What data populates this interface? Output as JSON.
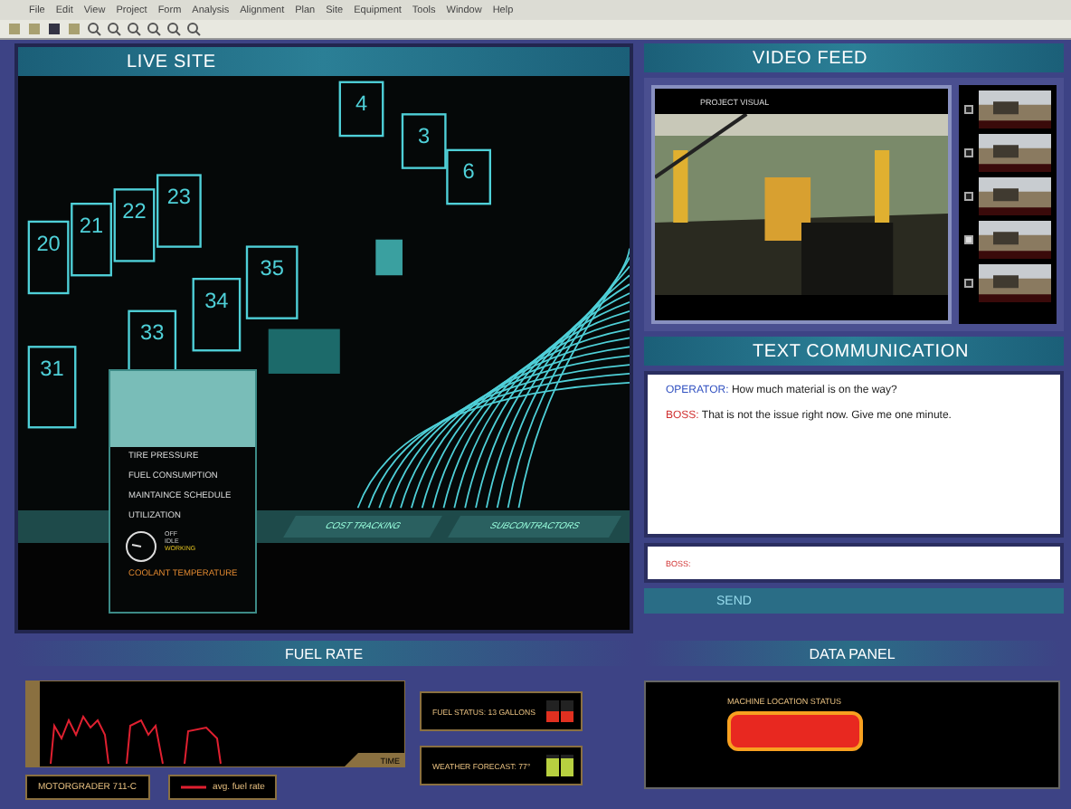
{
  "menu": [
    "File",
    "Edit",
    "View",
    "Project",
    "Form",
    "Analysis",
    "Alignment",
    "Plan",
    "Site",
    "Equipment",
    "Tools",
    "Window",
    "Help"
  ],
  "live_site": {
    "title": "LIVE SITE",
    "lots": [
      "20",
      "21",
      "22",
      "23",
      "31",
      "33",
      "34",
      "35",
      "3",
      "4",
      "6"
    ],
    "tabs": [
      {
        "label": "COST TRACKING",
        "selected": false
      },
      {
        "label": "SUBCONTRACTORS",
        "selected": false
      }
    ],
    "popup": {
      "items": [
        "TIRE PRESSURE",
        "FUEL CONSUMPTION",
        "MAINTAINCE SCHEDULE",
        "UTILIZATION"
      ],
      "legend": [
        {
          "label": "OFF",
          "selected": false
        },
        {
          "label": "IDLE",
          "selected": false
        },
        {
          "label": "WORKING",
          "selected": true
        }
      ],
      "footer": "COOLANT TEMPERATURE"
    }
  },
  "video_feed": {
    "title": "VIDEO FEED",
    "caption": "PROJECT VISUAL",
    "thumbnails": [
      {
        "checked": false
      },
      {
        "checked": false
      },
      {
        "checked": false
      },
      {
        "checked": true
      },
      {
        "checked": false
      }
    ]
  },
  "text_communication": {
    "title": "TEXT COMMUNICATION",
    "messages": [
      {
        "sender": "OPERATOR:",
        "text": "How much material is on the way?",
        "color": "#3050c0"
      },
      {
        "sender": "BOSS:",
        "text": "That is not the issue right now. Give me one minute.",
        "color": "#d03030"
      }
    ],
    "input_value": "BOSS:",
    "send": "SEND"
  },
  "fuel_rate": {
    "title": "FUEL RATE",
    "axis_label": "TIME",
    "machine": "MOTORGRADER 711-C",
    "legend": "avg. fuel rate"
  },
  "status_boxes": [
    {
      "label": "FUEL STATUS: 13 GALLONS",
      "meters": [
        {
          "level": 0.5
        },
        {
          "level": 0.5
        }
      ],
      "color": "#e03020"
    },
    {
      "label": "WEATHER FORECAST: 77°",
      "meters": [
        {
          "level": 0.8
        },
        {
          "level": 0.8
        }
      ],
      "color": "#b8d040"
    }
  ],
  "data_panel": {
    "title": "DATA PANEL",
    "heading": "MACHINE LOCATION STATUS"
  }
}
